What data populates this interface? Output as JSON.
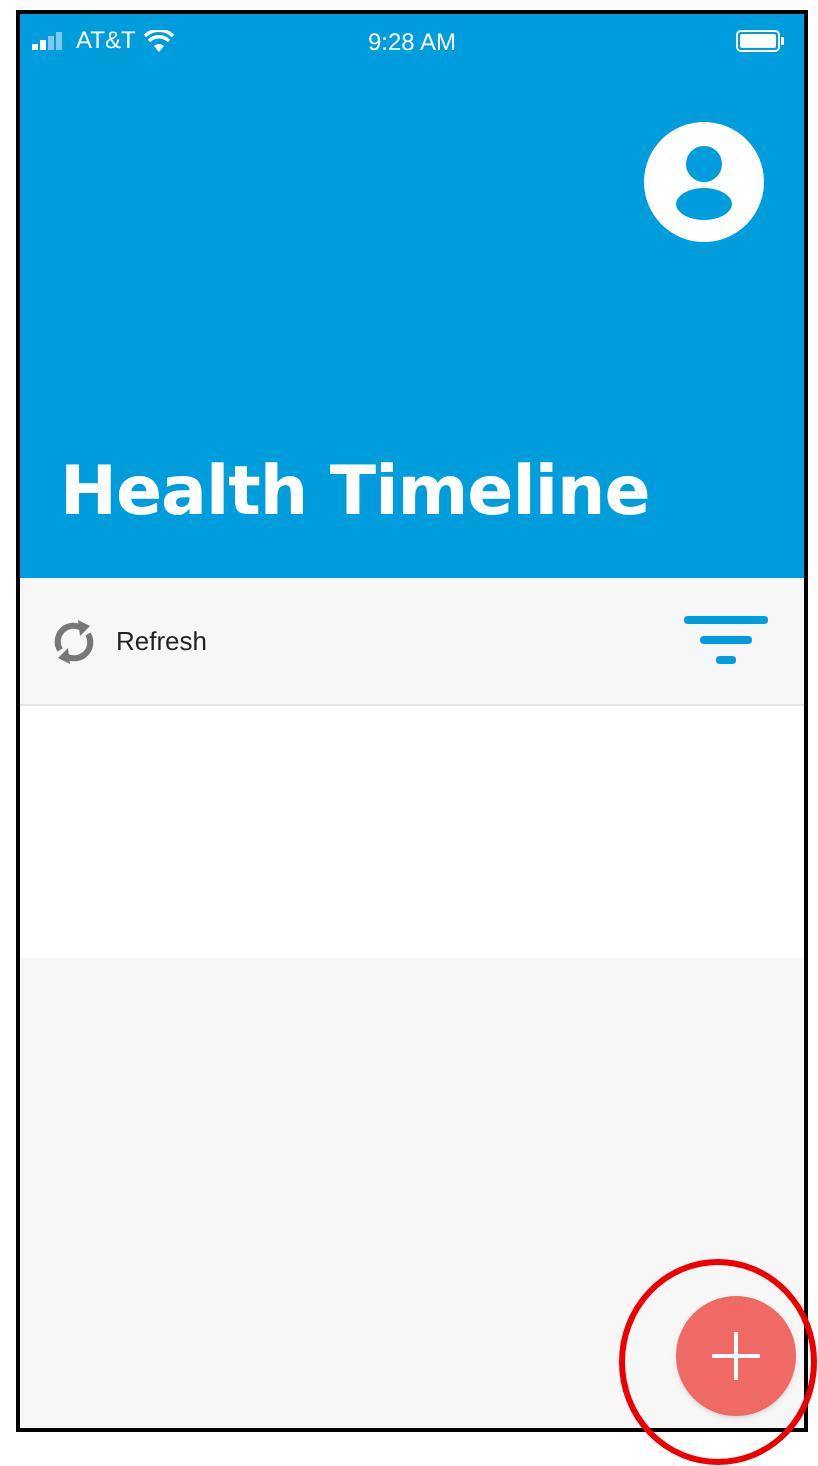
{
  "status_bar": {
    "carrier": "AT&T",
    "time": "9:28 AM"
  },
  "header": {
    "title": "Health Timeline"
  },
  "toolbar": {
    "refresh_label": "Refresh"
  }
}
